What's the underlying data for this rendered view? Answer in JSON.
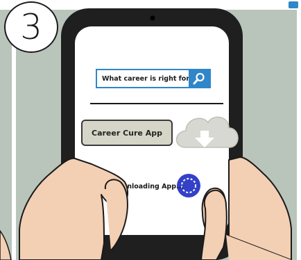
{
  "step": {
    "number": "3"
  },
  "phone": {
    "search": {
      "query": "What career is right for me"
    },
    "app_button": {
      "label": "Career Cure App"
    },
    "download": {
      "status": "Downloading App..."
    }
  },
  "colors": {
    "background": "#b9c4bb",
    "accent": "#2f86c8",
    "spinner": "#3340c8",
    "skin": "#f3cfb4",
    "device": "#1f1f1f"
  },
  "icons": [
    "search-icon",
    "cloud-download-icon",
    "loading-spinner-icon"
  ]
}
